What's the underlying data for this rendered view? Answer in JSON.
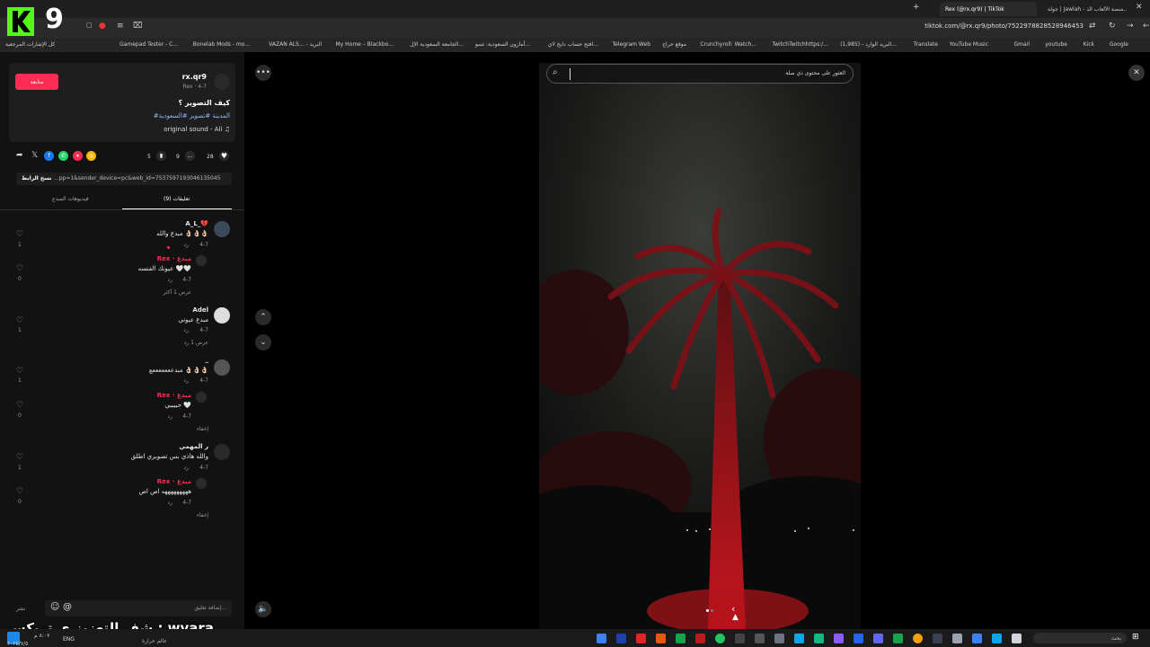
{
  "browser": {
    "tabs": [
      {
        "label": "Rex (@rx.qr9) | TikTok",
        "active": true
      },
      {
        "label": "جولة | Jawlah - منصة الألعاب الذ...",
        "active": false
      }
    ],
    "url": "tiktok.com/@rx.qr9/photo/7522978828528946453",
    "bookmarks": [
      "Google",
      "Kick",
      "youtube",
      "Gmail",
      "YouTube Music",
      "Translate",
      "البريد الوارد - (1,985)...",
      "TwitchTwitchhttps:/...",
      "Crunchyroll: Watch...",
      "موقع حراج",
      "Telegram Web",
      "افتح حساب دايخ لاي...",
      "أمازون السعودية: تسو...",
      "الجامعة السعودية الإل...",
      "My Home – Blackbo...",
      "VAZAN ALS... - البريد",
      "Bonelab Mods - mo...",
      "Gamepad Tester - C...",
      "كل الإشارات المرجعية"
    ]
  },
  "logo": {
    "text": "9"
  },
  "post": {
    "follow_label": "متابعة",
    "username": "rx.qr9",
    "meta": "Rex · 4-7",
    "caption": "كيف التصوير ؟",
    "tags": "#المدينة #تصوير #السعودية",
    "music": "original sound - Ali",
    "likes": "28",
    "comments_count": "9",
    "saves": "5",
    "link_text": "...pp=1&sender_device=pc&web_id=7537597193046135045",
    "copy_link_label": "نسخ الرابط"
  },
  "panel_tabs": {
    "comments": "تعليقات (9)",
    "creator_videos": "فيديوهات المبدع"
  },
  "comments": [
    {
      "name": "A_L_💔",
      "text": "مبدع والله 👌🏻👌🏻👌🏻",
      "date": "4-7",
      "reply": "رد",
      "likes": "1"
    },
    {
      "name": "Rex · مبدع",
      "text": "عيونك الفنسه 🤍🤍",
      "date": "4-7",
      "reply": "رد",
      "likes": "0",
      "more": "عرض 1 أكثر"
    },
    {
      "name": "Adel",
      "text": "مبدع عيوني",
      "date": "4-7",
      "reply": "رد",
      "likes": "1",
      "more": "عرض 1 رد"
    },
    {
      "name": "_",
      "text": "مبدعععععععع 👌🏻👌🏻👌🏻",
      "date": "4-7",
      "reply": "رد",
      "likes": "1"
    },
    {
      "name": "Rex · مبدع",
      "text": "حبيبيي 🤍",
      "date": "4-7",
      "reply": "رد",
      "likes": "0",
      "more": "إخفاء"
    },
    {
      "name": "ر المهمي",
      "text": "والله هاذي بس تصويري اطلق",
      "date": "4-7",
      "reply": "رد",
      "likes": "1"
    },
    {
      "name": "Rex · مبدع",
      "text": "هههههههههه اص اص",
      "date": "4-7",
      "reply": "رد",
      "likes": "0",
      "more": "إخفاء"
    }
  ],
  "comment_input": {
    "placeholder": "إضافة تعليق...",
    "post_label": "نشر"
  },
  "search": {
    "placeholder": "العثور على محتوى ذي صلة"
  },
  "overlay": {
    "text": "شف التعزيز ي تريكس : wyara"
  },
  "taskbar": {
    "lang": "ENG",
    "time": "٨:٠٧ م",
    "date": "٢٠٢٥/٧/٥",
    "weather": "عالم حرارة",
    "search": "بحث"
  },
  "colors": {
    "accent": "#fe2c55",
    "tag": "#8fb6ff"
  }
}
